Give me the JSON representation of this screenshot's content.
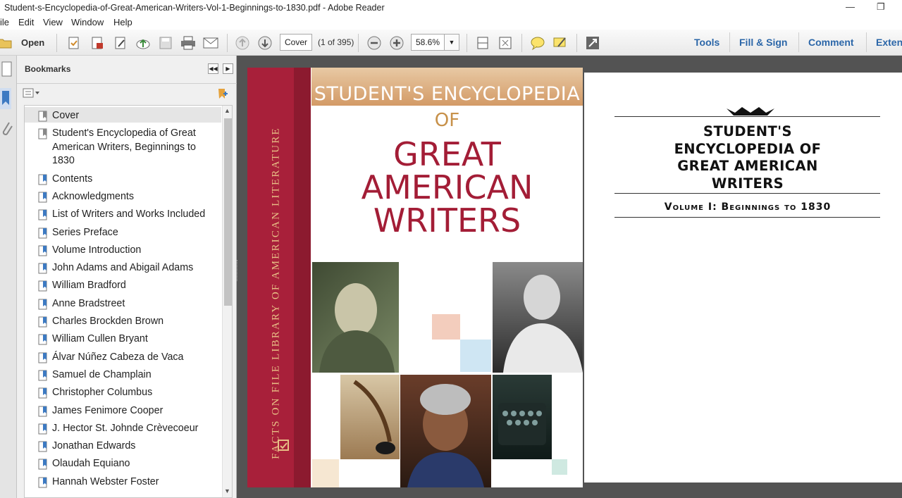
{
  "window": {
    "title": "Student-s-Encyclopedia-of-Great-American-Writers-Vol-1-Beginnings-to-1830.pdf - Adobe Reader"
  },
  "menu": [
    "ile",
    "Edit",
    "View",
    "Window",
    "Help"
  ],
  "toolbar": {
    "open_label": "Open",
    "page_value": "Cover",
    "page_count": "(1 of 395)",
    "zoom_value": "58.6%",
    "right_links": [
      "Tools",
      "Fill & Sign",
      "Comment",
      "Exten"
    ]
  },
  "bookmarks": {
    "title": "Bookmarks",
    "items": [
      {
        "label": "Cover"
      },
      {
        "label": "Student's Encyclopedia of Great American Writers, Beginnings to 1830"
      },
      {
        "label": "Contents"
      },
      {
        "label": "Acknowledgments"
      },
      {
        "label": "List of Writers and Works Included"
      },
      {
        "label": "Series Preface"
      },
      {
        "label": "Volume Introduction"
      },
      {
        "label": "John Adams and Abigail Adams"
      },
      {
        "label": "William Bradford"
      },
      {
        "label": "Anne Bradstreet"
      },
      {
        "label": "Charles Brockden Brown"
      },
      {
        "label": "William Cullen Bryant"
      },
      {
        "label": "Álvar Núñez Cabeza de Vaca"
      },
      {
        "label": "Samuel de Champlain"
      },
      {
        "label": "Christopher Columbus"
      },
      {
        "label": "James Fenimore Cooper"
      },
      {
        "label": "J. Hector St. Johnde Crèvecoeur"
      },
      {
        "label": "Jonathan Edwards"
      },
      {
        "label": "Olaudah Equiano"
      },
      {
        "label": "Hannah Webster Foster"
      }
    ]
  },
  "cover": {
    "spine_text": "FACTS ON FILE LIBRARY OF AMERICAN LITERATURE",
    "title_top": "STUDENT'S ENCYCLOPEDIA",
    "title_of": "OF",
    "title_main": [
      "GREAT",
      "AMERICAN",
      "WRITERS"
    ]
  },
  "title_page": {
    "title_lines": [
      "STUDENT'S",
      "ENCYCLOPEDIA OF",
      "GREAT AMERICAN",
      "WRITERS"
    ],
    "volume": "Volume I: Beginnings to 1830"
  },
  "colors": {
    "link_blue": "#2b66a8",
    "spine_red": "#a8203a",
    "cover_title_red": "#a31d36",
    "doc_background": "#535353"
  }
}
